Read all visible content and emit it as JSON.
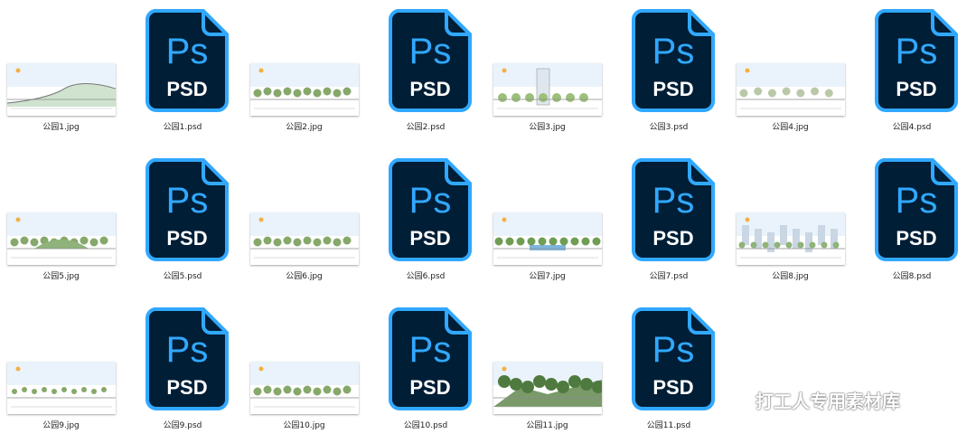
{
  "psd_badge": {
    "brand": "Ps",
    "type": "PSD"
  },
  "rows": [
    [
      {
        "kind": "jpg",
        "label": "公园1.jpg",
        "scene": "hill"
      },
      {
        "kind": "psd",
        "label": "公园1.psd"
      },
      {
        "kind": "jpg",
        "label": "公园2.jpg",
        "scene": "trees"
      },
      {
        "kind": "psd",
        "label": "公园2.psd"
      },
      {
        "kind": "jpg",
        "label": "公园3.jpg",
        "scene": "building"
      },
      {
        "kind": "psd",
        "label": "公园3.psd"
      },
      {
        "kind": "jpg",
        "label": "公园4.jpg",
        "scene": "sparse"
      },
      {
        "kind": "psd",
        "label": "公园4.psd"
      }
    ],
    [
      {
        "kind": "jpg",
        "label": "公园5.jpg",
        "scene": "mound"
      },
      {
        "kind": "psd",
        "label": "公园5.psd"
      },
      {
        "kind": "jpg",
        "label": "公园6.jpg",
        "scene": "flat"
      },
      {
        "kind": "psd",
        "label": "公园6.psd"
      },
      {
        "kind": "jpg",
        "label": "公园7.jpg",
        "scene": "water"
      },
      {
        "kind": "psd",
        "label": "公园7.psd"
      },
      {
        "kind": "jpg",
        "label": "公园8.jpg",
        "scene": "city"
      },
      {
        "kind": "psd",
        "label": "公园8.psd"
      }
    ],
    [
      {
        "kind": "jpg",
        "label": "公园9.jpg",
        "scene": "low"
      },
      {
        "kind": "psd",
        "label": "公园9.psd"
      },
      {
        "kind": "jpg",
        "label": "公园10.jpg",
        "scene": "flat"
      },
      {
        "kind": "psd",
        "label": "公园10.psd"
      },
      {
        "kind": "jpg",
        "label": "公园11.jpg",
        "scene": "forest"
      },
      {
        "kind": "psd",
        "label": "公园11.psd"
      }
    ]
  ],
  "watermark": {
    "text": "打工人专用素材库",
    "icon": "wechat-icon"
  },
  "colors": {
    "ps_bg": "#001e36",
    "ps_accent": "#31a8ff",
    "ps_text": "#ffffff"
  }
}
